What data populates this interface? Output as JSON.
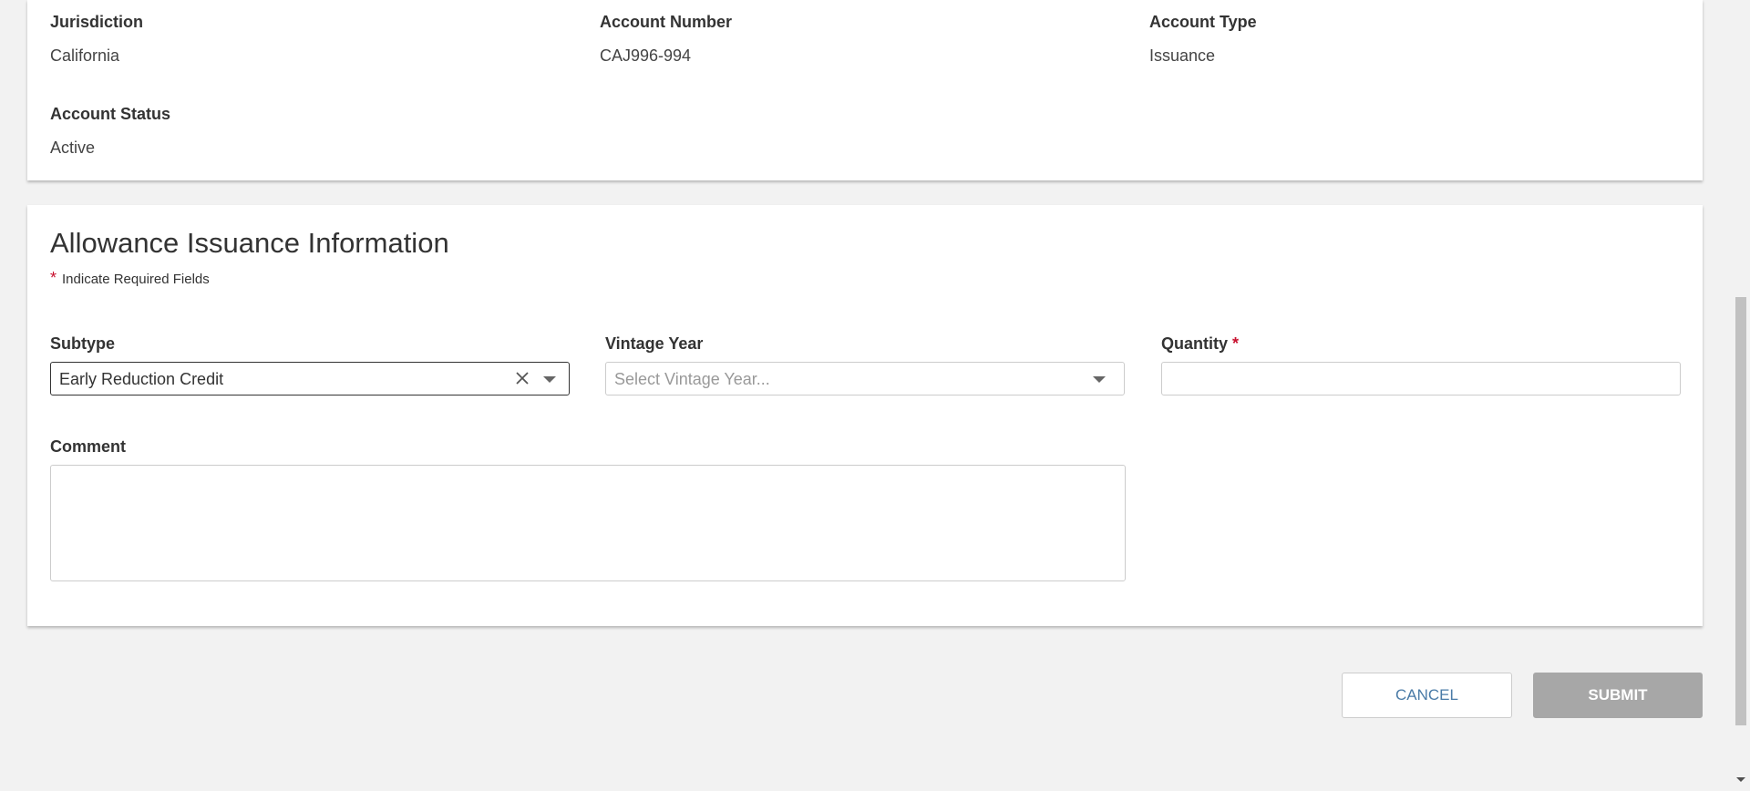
{
  "account_info": {
    "jurisdiction_label": "Jurisdiction",
    "jurisdiction_value": "California",
    "account_number_label": "Account Number",
    "account_number_value": "CAJ996-994",
    "account_type_label": "Account Type",
    "account_type_value": "Issuance",
    "account_status_label": "Account Status",
    "account_status_value": "Active"
  },
  "issuance": {
    "title": "Allowance Issuance Information",
    "required_star": "*",
    "required_note": "Indicate Required Fields",
    "subtype": {
      "label": "Subtype",
      "value": "Early Reduction Credit"
    },
    "vintage_year": {
      "label": "Vintage Year",
      "placeholder": "Select Vintage Year..."
    },
    "quantity": {
      "label": "Quantity",
      "required_star": "*",
      "value": ""
    },
    "comment": {
      "label": "Comment",
      "value": ""
    }
  },
  "actions": {
    "cancel_label": "CANCEL",
    "submit_label": "SUBMIT"
  },
  "icons": {
    "clear": "close-icon",
    "dropdown": "chevron-down-icon"
  },
  "colors": {
    "required": "#c8102e",
    "cancel_text": "#4a7ba7",
    "submit_disabled_bg": "#a7a7a7",
    "page_bg": "#f2f2f2"
  }
}
